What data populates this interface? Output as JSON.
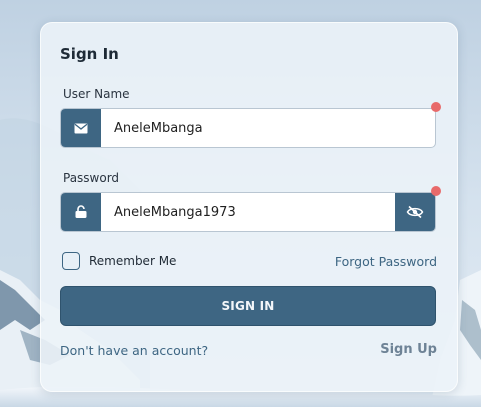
{
  "form": {
    "title": "Sign In",
    "username": {
      "label": "User Name",
      "value": "AneleMbanga",
      "icon": "mail-icon",
      "required": true
    },
    "password": {
      "label": "Password",
      "value": "AneleMbanga1973",
      "icon": "unlock-icon",
      "toggle_icon": "eye-off-icon",
      "required": true
    },
    "remember_label": "Remember Me",
    "forgot_label": "Forgot Password",
    "signin_label": "SIGN IN",
    "no_account_text": "Don't have an account?",
    "signup_label": "Sign Up"
  },
  "colors": {
    "accent": "#3e6683",
    "required_dot": "#e86a6a"
  }
}
